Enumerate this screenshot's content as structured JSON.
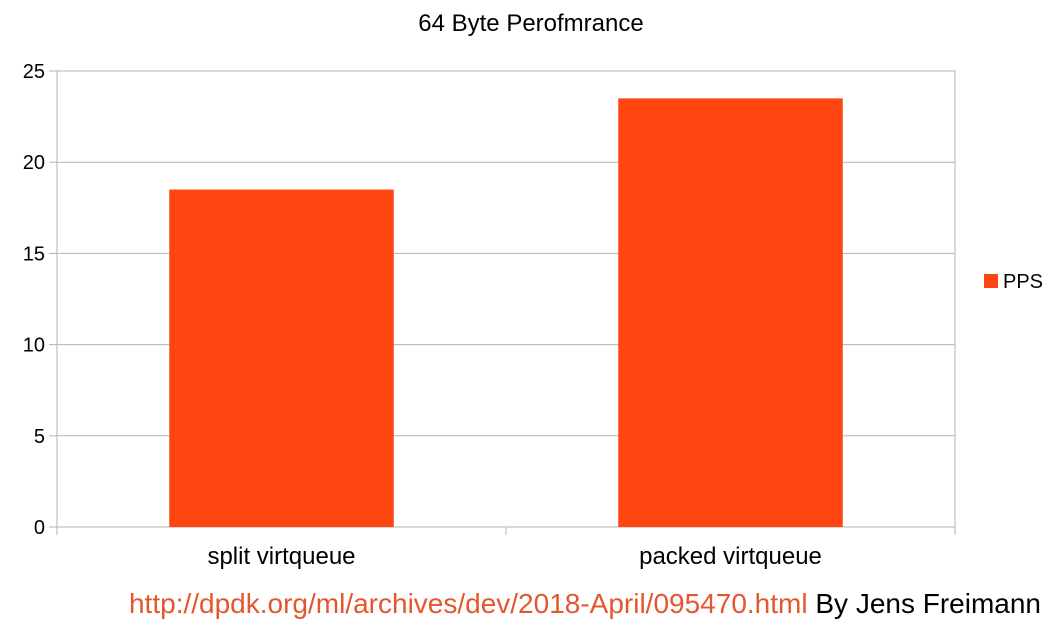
{
  "chart_data": {
    "type": "bar",
    "title": "64 Byte Perofmrance",
    "categories": [
      "split virtqueue",
      "packed virtqueue"
    ],
    "series": [
      {
        "name": "PPS",
        "color": "#ff4612",
        "values": [
          18.5,
          23.5
        ]
      }
    ],
    "ylim": [
      0,
      25
    ],
    "yticks": [
      0,
      5,
      10,
      15,
      20,
      25
    ],
    "grid": true,
    "legend": "right"
  },
  "footer": {
    "link_text": "http://dpdk.org/ml/archives/dev/2018-April/095470.html",
    "link_color": "#e4572e",
    "credit_text": "By Jens Freimann"
  }
}
